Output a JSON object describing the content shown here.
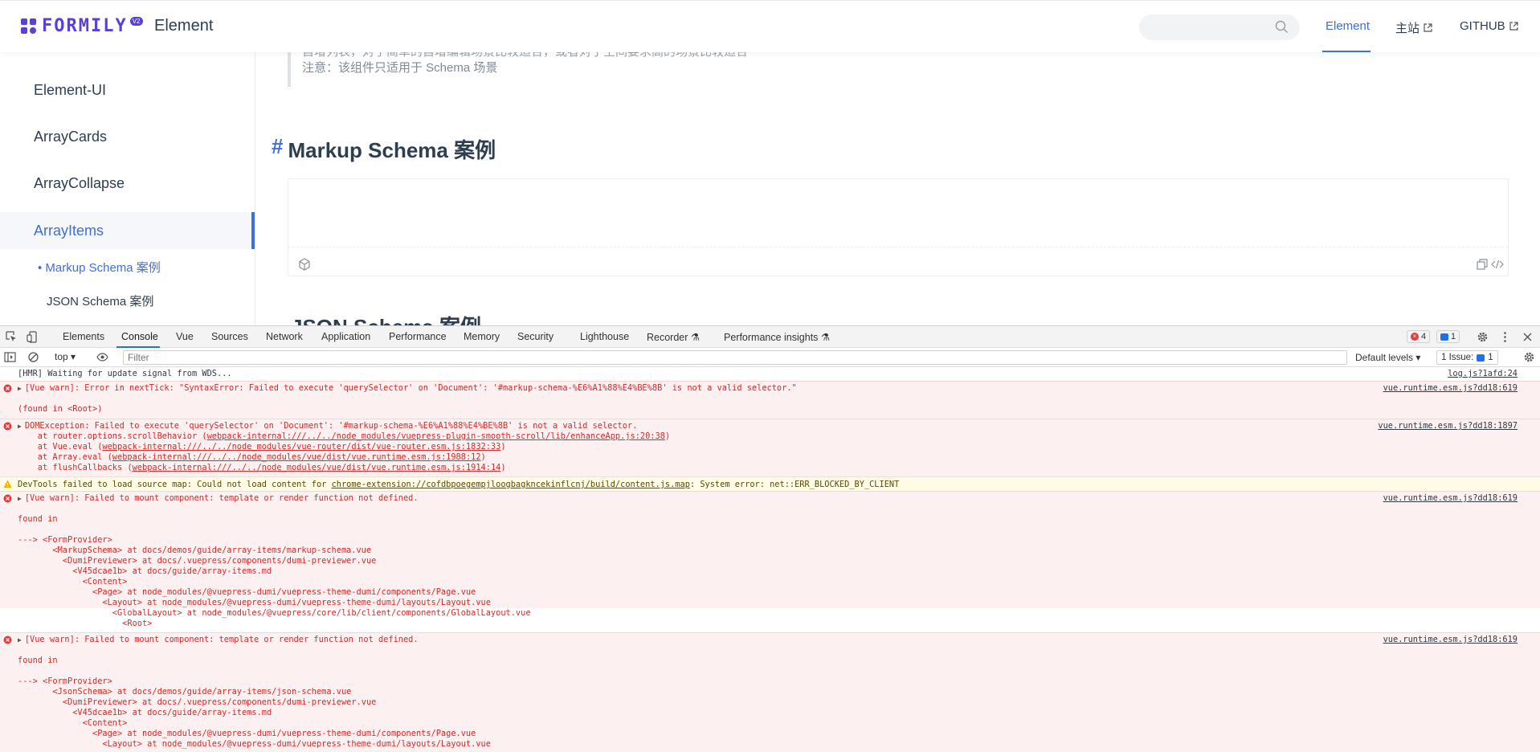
{
  "navbar": {
    "logo_text": "FORMILY",
    "logo_badge": "V2",
    "site_title": "Element",
    "search_placeholder": "",
    "links": [
      {
        "label": "Element",
        "active": true,
        "external": false
      },
      {
        "label": "主站",
        "active": false,
        "external": true
      },
      {
        "label": "GITHUB",
        "active": false,
        "external": true
      }
    ]
  },
  "sidebar": {
    "items": [
      "Element-UI",
      "ArrayCards",
      "ArrayCollapse",
      "ArrayItems"
    ],
    "active_index": 3,
    "sub_items": [
      {
        "label": "• Markup Schema 案例",
        "active": true
      },
      {
        "label": "JSON Schema 案例",
        "active": false
      }
    ]
  },
  "content": {
    "quote_line1": "自增列表，对于简单的自增编辑场景比较适合，或者对于空间要求高的场景比较适合",
    "quote_line2": "注意：该组件只适用于 Schema 场景",
    "heading_hash": "#",
    "heading": "Markup Schema 案例",
    "heading2": "JSON Schema 案例"
  },
  "devtools": {
    "tabs": [
      "Elements",
      "Console",
      "Vue",
      "Sources",
      "Network",
      "Application",
      "Performance",
      "Memory",
      "Security",
      "Lighthouse",
      "Recorder ⚗",
      "Performance insights ⚗"
    ],
    "active_tab": "Console",
    "error_count": "4",
    "message_count": "1",
    "context": "top ▾",
    "filter_placeholder": "Filter",
    "levels_label": "Default levels ▾",
    "issues_label": "1 Issue:",
    "issues_count": "1"
  },
  "console": {
    "hmr_text": "[HMR] Waiting for update signal from WDS...",
    "hmr_src": "log.js?1afd:24",
    "m1_line1": "[Vue warn]: Error in nextTick: \"SyntaxError: Failed to execute 'querySelector' on 'Document': '#markup-schema-%E6%A1%88%E4%BE%8B' is not a valid selector.\"",
    "m1_line2": "(found in <Root>)",
    "m1_src": "vue.runtime.esm.js?dd18:619",
    "m2_line1": "DOMException: Failed to execute 'querySelector' on 'Document': '#markup-schema-%E6%A1%88%E4%BE%8B' is not a valid selector.",
    "m2_l2_pre": "    at router.options.scrollBehavior (",
    "m2_l2_link": "webpack-internal:///../../node_modules/vuepress-plugin-smooth-scroll/lib/enhanceApp.js:20:38",
    "m2_l3_pre": "    at Vue.eval (",
    "m2_l3_link": "webpack-internal:///../../node_modules/vue-router/dist/vue-router.esm.js:1832:33",
    "m2_l4_pre": "    at Array.eval (",
    "m2_l4_link": "webpack-internal:///../../node_modules/vue/dist/vue.runtime.esm.js:1988:12",
    "m2_l5_pre": "    at flushCallbacks (",
    "m2_l5_link": "webpack-internal:///../../node_modules/vue/dist/vue.runtime.esm.js:1914:14",
    "close_paren": ")",
    "m2_src": "vue.runtime.esm.js?dd18:1897",
    "warn_pre": "DevTools failed to load source map: Could not load content for ",
    "warn_link": "chrome-extension://cofdbpoegempjloogbagkncekinflcnj/build/content.js.map",
    "warn_post": ": System error: net::ERR_BLOCKED_BY_CLIENT",
    "m3_line1": "[Vue warn]: Failed to mount component: template or render function not defined.",
    "m3_found": "found in",
    "m3_tree": [
      "---> <FormProvider>",
      "       <MarkupSchema> at docs/demos/guide/array-items/markup-schema.vue",
      "         <DumiPreviewer> at docs/.vuepress/components/dumi-previewer.vue",
      "           <V45dcae1b> at docs/guide/array-items.md",
      "             <Content>",
      "               <Page> at node_modules/@vuepress-dumi/vuepress-theme-dumi/components/Page.vue",
      "                 <Layout> at node_modules/@vuepress-dumi/vuepress-theme-dumi/layouts/Layout.vue",
      "                   <GlobalLayout> at node_modules/@vuepress/core/lib/client/components/GlobalLayout.vue",
      "                     <Root>"
    ],
    "m3_src": "vue.runtime.esm.js?dd18:619",
    "m4_line1": "[Vue warn]: Failed to mount component: template or render function not defined.",
    "m4_found": "found in",
    "m4_tree": [
      "---> <FormProvider>",
      "       <JsonSchema> at docs/demos/guide/array-items/json-schema.vue",
      "         <DumiPreviewer> at docs/.vuepress/components/dumi-previewer.vue",
      "           <V45dcae1b> at docs/guide/array-items.md",
      "             <Content>",
      "               <Page> at node_modules/@vuepress-dumi/vuepress-theme-dumi/components/Page.vue",
      "                 <Layout> at node_modules/@vuepress-dumi/vuepress-theme-dumi/layouts/Layout.vue"
    ],
    "m4_src": "vue.runtime.esm.js?dd18:619"
  },
  "colors": {
    "accent": "#3f6fd8",
    "brand": "#5b3fd6",
    "error_text": "#d52b2b",
    "error_bg": "#fdf0f0",
    "warn_bg": "#fffbe6"
  },
  "icons": [
    "logo-icon",
    "search-icon",
    "external-link-icon",
    "codesandbox-icon",
    "copy-icon",
    "code-icon",
    "inspect-icon",
    "device-icon",
    "settings-icon",
    "more-icon",
    "close-icon",
    "sidebar-toggle-icon",
    "clear-icon",
    "eye-icon",
    "error-icon",
    "warning-icon"
  ]
}
